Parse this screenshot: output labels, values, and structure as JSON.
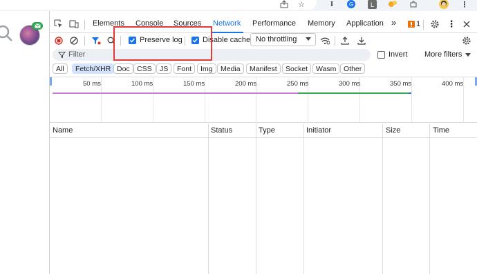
{
  "devtools": {
    "tabs": [
      {
        "label": "Elements"
      },
      {
        "label": "Console"
      },
      {
        "label": "Sources"
      },
      {
        "label": "Network",
        "active": true
      },
      {
        "label": "Performance"
      },
      {
        "label": "Memory"
      },
      {
        "label": "Application"
      }
    ],
    "more_tabs": "»",
    "issues_count": "1"
  },
  "toolbar": {
    "preserve_log": {
      "label": "Preserve log",
      "checked": true
    },
    "disable_cache": {
      "label": "Disable cache",
      "checked": true
    },
    "throttling": "No throttling"
  },
  "filter": {
    "placeholder": "Filter",
    "invert_label": "Invert",
    "invert_checked": false,
    "more_filters": "More filters"
  },
  "type_chips": [
    {
      "label": "All"
    },
    {
      "label": "Fetch/XHR",
      "active": true
    },
    {
      "label": "Doc"
    },
    {
      "label": "CSS"
    },
    {
      "label": "JS"
    },
    {
      "label": "Font"
    },
    {
      "label": "Img"
    },
    {
      "label": "Media"
    },
    {
      "label": "Manifest"
    },
    {
      "label": "Socket"
    },
    {
      "label": "Wasm"
    },
    {
      "label": "Other"
    }
  ],
  "overview": {
    "ticks": [
      "50 ms",
      "100 ms",
      "150 ms",
      "200 ms",
      "250 ms",
      "300 ms",
      "350 ms",
      "400 ms"
    ]
  },
  "table": {
    "columns": [
      "Name",
      "Status",
      "Type",
      "Initiator",
      "Size",
      "Time"
    ],
    "rows": []
  },
  "colors": {
    "accent": "#1a73e8",
    "chip_active": "#d3e3fd",
    "highlight_box": "#e53935",
    "timeline_purple": "#c77dd6",
    "timeline_green": "#34a853"
  }
}
